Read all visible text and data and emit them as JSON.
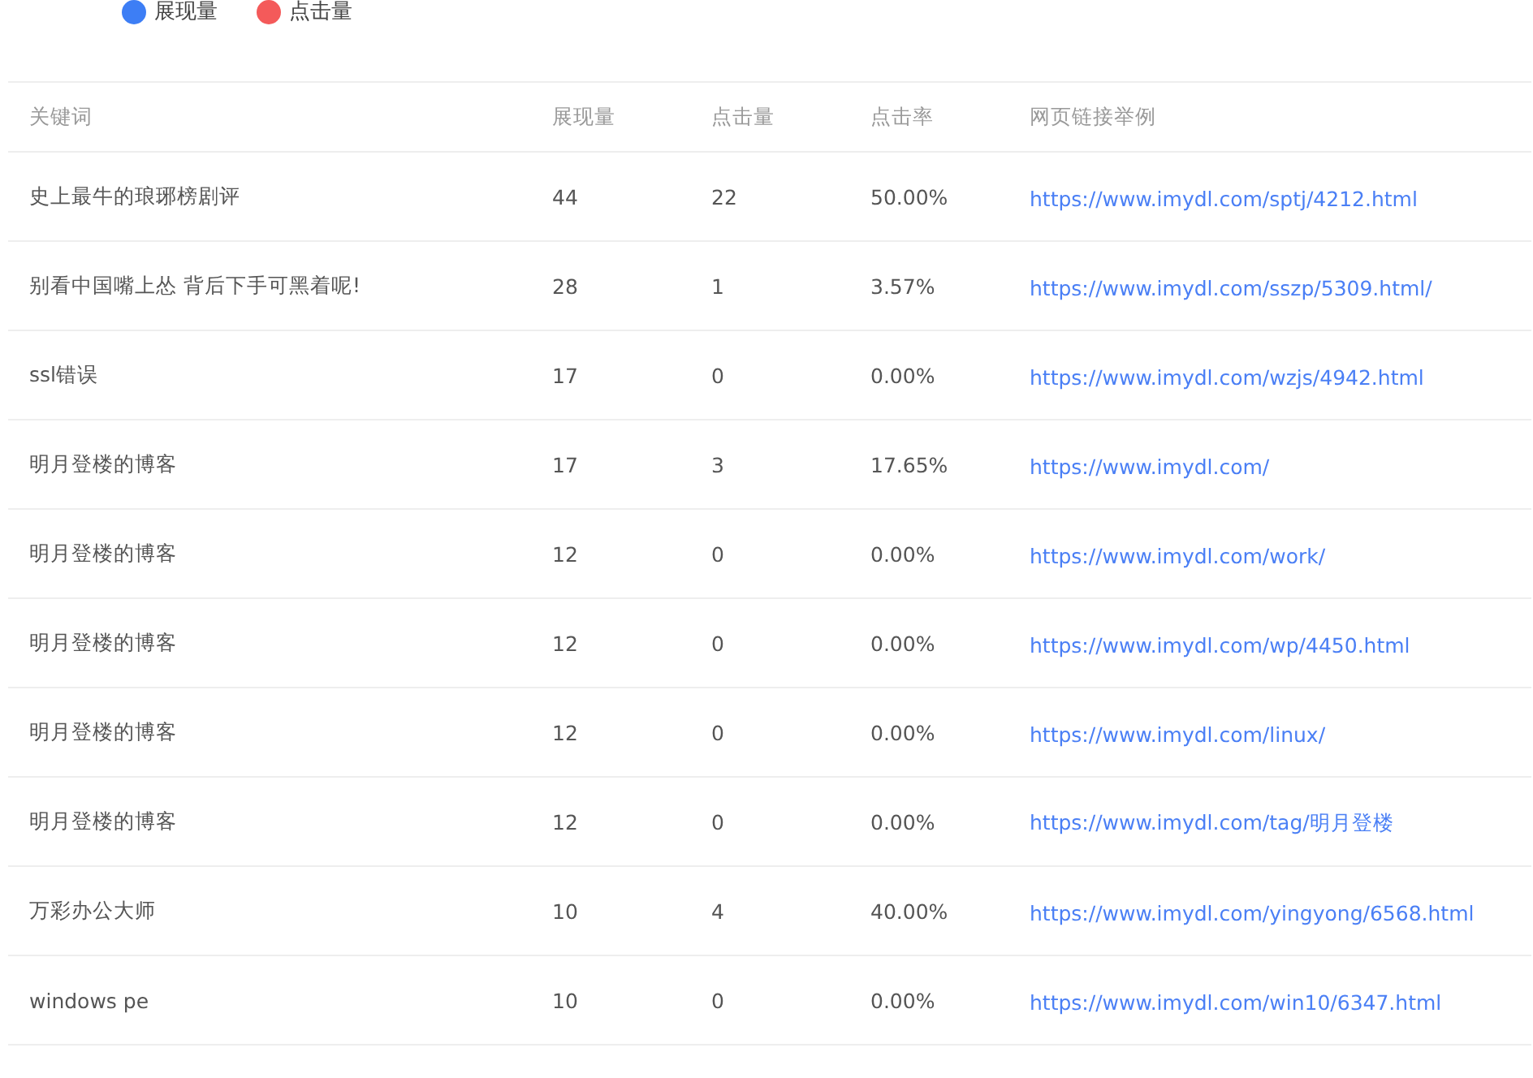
{
  "legend": [
    {
      "label": "展现量",
      "color": "#3d7ef5"
    },
    {
      "label": "点击量",
      "color": "#f45a5a"
    }
  ],
  "table": {
    "columns": [
      "关键词",
      "展现量",
      "点击量",
      "点击率",
      "网页链接举例"
    ],
    "rows": [
      [
        "史上最牛的琅琊榜剧评",
        "44",
        "22",
        "50.00%",
        "https://www.imydl.com/sptj/4212.html"
      ],
      [
        "别看中国嘴上怂 背后下手可黑着呢!",
        "28",
        "1",
        "3.57%",
        "https://www.imydl.com/sszp/5309.html/"
      ],
      [
        "ssl错误",
        "17",
        "0",
        "0.00%",
        "https://www.imydl.com/wzjs/4942.html"
      ],
      [
        "明月登楼的博客",
        "17",
        "3",
        "17.65%",
        "https://www.imydl.com/"
      ],
      [
        "明月登楼的博客",
        "12",
        "0",
        "0.00%",
        "https://www.imydl.com/work/"
      ],
      [
        "明月登楼的博客",
        "12",
        "0",
        "0.00%",
        "https://www.imydl.com/wp/4450.html"
      ],
      [
        "明月登楼的博客",
        "12",
        "0",
        "0.00%",
        "https://www.imydl.com/linux/"
      ],
      [
        "明月登楼的博客",
        "12",
        "0",
        "0.00%",
        "https://www.imydl.com/tag/明月登楼"
      ],
      [
        "万彩办公大师",
        "10",
        "4",
        "40.00%",
        "https://www.imydl.com/yingyong/6568.html"
      ],
      [
        "windows pe",
        "10",
        "0",
        "0.00%",
        "https://www.imydl.com/win10/6347.html"
      ]
    ]
  }
}
